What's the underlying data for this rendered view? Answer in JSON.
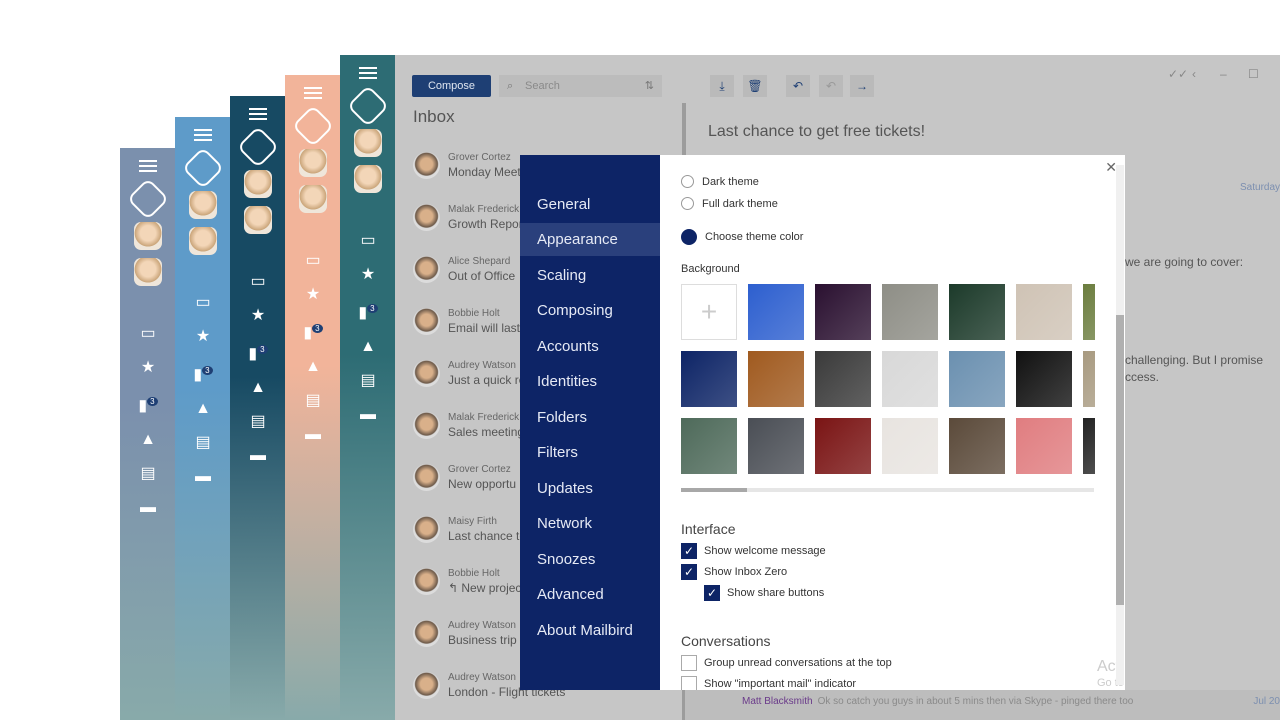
{
  "sidebar_strips": [
    {
      "color": "#7b90ad",
      "counter": "3"
    },
    {
      "color": "#5e9bc9",
      "counter": "3"
    },
    {
      "color": "#174a63",
      "counter": "3"
    },
    {
      "color": "#f2b49a",
      "counter": "3"
    },
    {
      "color": "#2d6c74",
      "counter": "3"
    }
  ],
  "toolbar": {
    "compose": "Compose",
    "search_placeholder": "Search"
  },
  "inbox": {
    "title": "Inbox",
    "mails": [
      {
        "name": "Grover Cortez",
        "subject": "Monday Meeting"
      },
      {
        "name": "Malak Frederick",
        "subject": "Growth Report"
      },
      {
        "name": "Alice Shepard",
        "subject": "Out of Office"
      },
      {
        "name": "Bobbie Holt",
        "subject": "Email will last"
      },
      {
        "name": "Audrey Watson",
        "subject": "Just a quick re"
      },
      {
        "name": "Malak Frederick",
        "subject": "Sales meeting"
      },
      {
        "name": "Grover Cortez",
        "subject": "New opportu"
      },
      {
        "name": "Maisy Firth",
        "subject": "Last chance to"
      },
      {
        "name": "Bobbie Holt",
        "subject": "↰ New project"
      },
      {
        "name": "Audrey Watson",
        "subject": "Business trip"
      },
      {
        "name": "Audrey Watson",
        "subject": "London - Flight tickets"
      }
    ]
  },
  "reader": {
    "subject": "Last chance to get free tickets!",
    "date": "Saturday",
    "line1": "we are going to cover:",
    "line2": "challenging. But I promise",
    "line3": "ccess.",
    "watermark1": "Acti",
    "watermark2": "Go to"
  },
  "bottom_message": {
    "sender": "Matt Blacksmith",
    "text": "Ok so catch you guys in about 5 mins then via Skype - pinged there too",
    "date": "Jul 20"
  },
  "settings": {
    "nav": [
      "General",
      "Appearance",
      "Scaling",
      "Composing",
      "Accounts",
      "Identities",
      "Folders",
      "Filters",
      "Updates",
      "Network",
      "Snoozes",
      "Advanced",
      "About Mailbird"
    ],
    "selected": "Appearance",
    "themes": {
      "dark": "Dark theme",
      "full_dark": "Full dark theme",
      "choose": "Choose theme color",
      "selected": "Choose theme color",
      "theme_color": "#0d2466"
    },
    "background_label": "Background",
    "tiles": [
      [
        "#ffffff",
        "#2d5fcf",
        "#2a1030",
        "#8e8e86",
        "#1c3a2a",
        "#cfc3b5",
        "#6b7d3e"
      ],
      [
        "#0d2466",
        "#a05a1f",
        "#3a3a3a",
        "#d8d8d8",
        "#6b90b0",
        "#111111",
        "#a89a80"
      ],
      [
        "#4e6a5a",
        "#4a4e55",
        "#7a1414",
        "#e8e4e0",
        "#5b4a3a",
        "#e07d80",
        "#222222"
      ]
    ],
    "interface_title": "Interface",
    "interface": [
      {
        "label": "Show welcome message",
        "checked": true
      },
      {
        "label": "Show Inbox Zero",
        "checked": true
      },
      {
        "label": "Show share buttons",
        "checked": true
      }
    ],
    "conversations_title": "Conversations",
    "conversations": [
      {
        "label": "Group unread conversations at the top",
        "checked": false
      },
      {
        "label": "Show \"important mail\" indicator",
        "checked": false
      }
    ]
  }
}
